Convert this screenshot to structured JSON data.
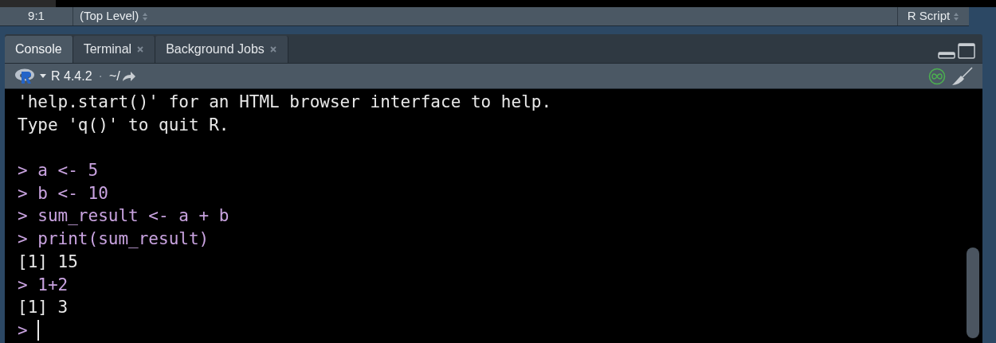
{
  "status_bar": {
    "position": "9:1",
    "scope": "(Top Level)",
    "file_type": "R Script"
  },
  "tabs": [
    {
      "label": "Console",
      "selected": true,
      "closable": false
    },
    {
      "label": "Terminal",
      "selected": false,
      "closable": true
    },
    {
      "label": "Background Jobs",
      "selected": false,
      "closable": true
    }
  ],
  "toolbar": {
    "version": "R 4.4.2",
    "separator": "·",
    "path": "~/"
  },
  "console": [
    {
      "kind": "output",
      "text": "'help.start()' for an HTML browser interface to help."
    },
    {
      "kind": "output",
      "text": "Type 'q()' to quit R."
    },
    {
      "kind": "blank"
    },
    {
      "kind": "input",
      "prompt": ">",
      "text": "a <- 5"
    },
    {
      "kind": "input",
      "prompt": ">",
      "text": "b <- 10"
    },
    {
      "kind": "input",
      "prompt": ">",
      "text": "sum_result <- a + b"
    },
    {
      "kind": "input",
      "prompt": ">",
      "text": "print(sum_result)"
    },
    {
      "kind": "output",
      "text": "[1] 15"
    },
    {
      "kind": "input",
      "prompt": ">",
      "text": "1+2"
    },
    {
      "kind": "output",
      "text": "[1] 3"
    },
    {
      "kind": "cursor",
      "prompt": ">"
    }
  ]
}
